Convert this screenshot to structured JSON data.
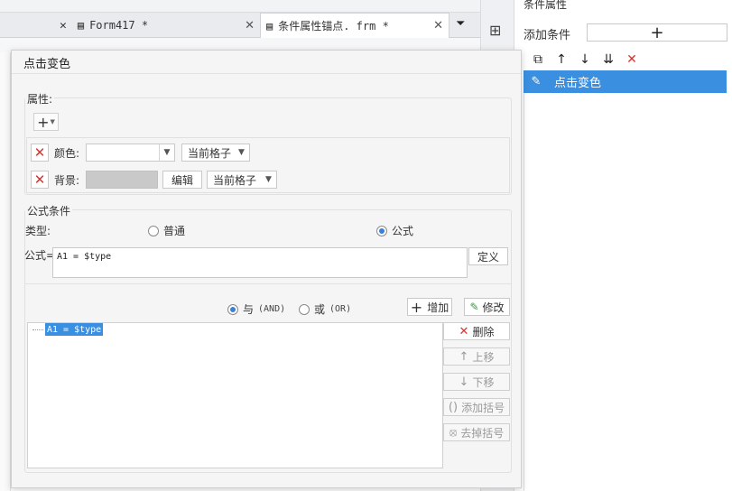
{
  "app": {
    "tabs": [
      {
        "label": "Form417 *"
      },
      {
        "label": "条件属性锚点. frm *"
      }
    ]
  },
  "right_panel": {
    "title": "条件属性",
    "add_condition_label": "添加条件",
    "add_button_label": "+",
    "conditions": [
      {
        "label": "点击变色",
        "selected": true
      }
    ]
  },
  "dialog": {
    "title": "点击变色",
    "attributes": {
      "group_label": "属性:",
      "add_label": "+",
      "rows": [
        {
          "label": "颜色:",
          "value": "",
          "scope": "当前格子"
        },
        {
          "label": "背景:",
          "edit_label": "编辑",
          "scope": "当前格子"
        }
      ]
    },
    "formula": {
      "group_label": "公式条件",
      "type_label": "类型:",
      "type_options": [
        {
          "label": "普通",
          "selected": false
        },
        {
          "label": "公式",
          "selected": true
        }
      ],
      "formula_label": "公式=",
      "formula_value": "A1 = $type",
      "define_button": "定义",
      "logic_options": [
        {
          "label": "与",
          "suffix": "(AND)",
          "selected": true
        },
        {
          "label": "或",
          "suffix": "(OR)",
          "selected": false
        }
      ],
      "add_button": "增加",
      "modify_button": "修改",
      "tree_items": [
        "A1 = $type"
      ],
      "side_buttons": {
        "delete": "删除",
        "move_up": "上移",
        "move_down": "下移",
        "add_bracket": "添加括号",
        "remove_bracket": "去掉括号"
      }
    }
  },
  "colors": {
    "selection_blue": "#3b8fe0",
    "delete_red": "#e0312b"
  }
}
